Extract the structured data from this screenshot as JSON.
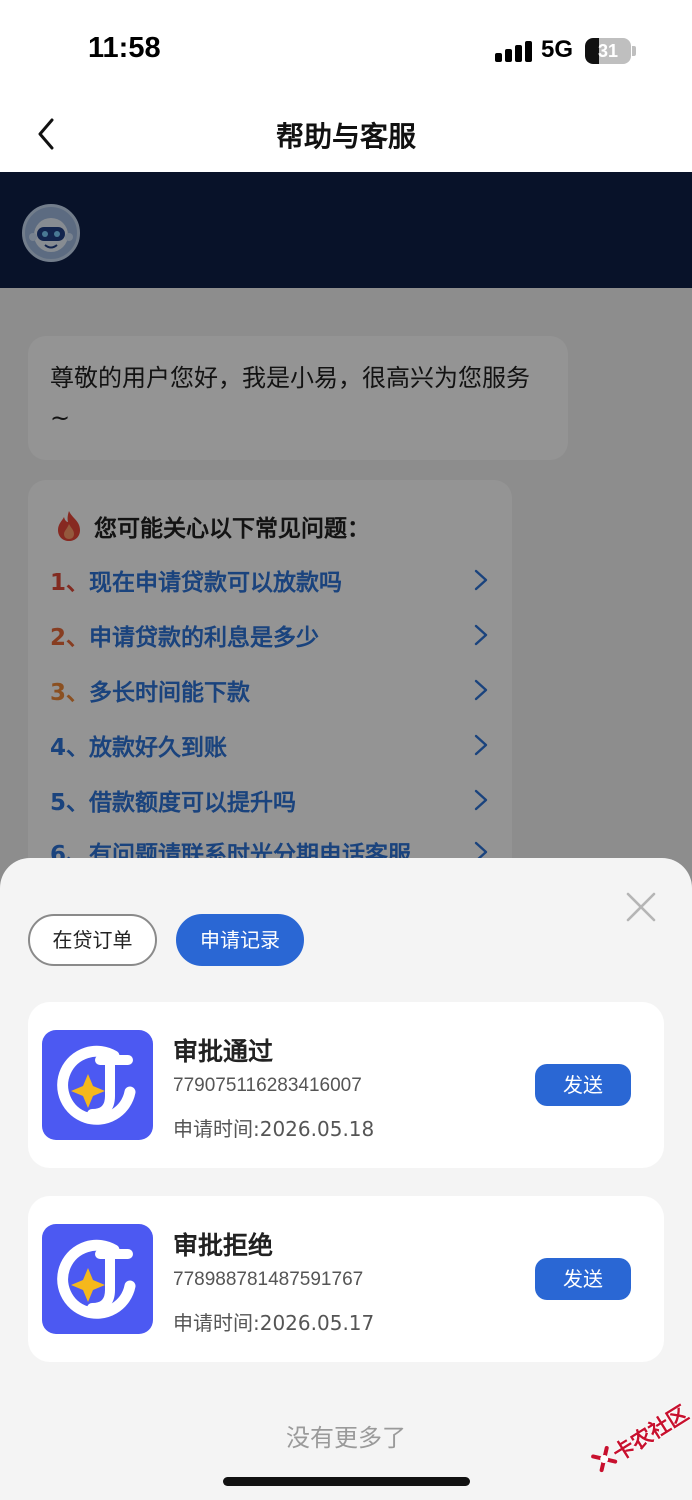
{
  "status_bar": {
    "time": "11:58",
    "network": "5G",
    "battery": "31",
    "battery_level": 0.31
  },
  "nav": {
    "title": "帮助与客服",
    "back_icon": "chevron-left-icon"
  },
  "chat": {
    "avatar_icon": "robot-avatar-icon",
    "greeting": "尊敬的用户您好，我是小易，很高兴为您服务~",
    "faq": {
      "header": "您可能关心以下常见问题：",
      "header_icon": "fire-icon",
      "items": [
        {
          "num": "1、",
          "text": "现在申请贷款可以放款吗",
          "num_color": "#e04a3a"
        },
        {
          "num": "2、",
          "text": "申请贷款的利息是多少",
          "num_color": "#e86a3a"
        },
        {
          "num": "3、",
          "text": "多长时间能下款",
          "num_color": "#ef8a3a"
        },
        {
          "num": "4、",
          "text": "放款好久到账",
          "num_color": "#2e74d8"
        },
        {
          "num": "5、",
          "text": "借款额度可以提升吗",
          "num_color": "#2e74d8"
        },
        {
          "num": "6、",
          "text": "有问题请联系时光分期电话客服",
          "num_color": "#2e74d8"
        }
      ]
    }
  },
  "sheet": {
    "close_icon": "close-icon",
    "tabs": [
      {
        "label": "在贷订单",
        "active": false
      },
      {
        "label": "申请记录",
        "active": true
      }
    ],
    "records": [
      {
        "status": "审批通过",
        "order_id": "779075116283416007",
        "apply_time": "申请时间:2026.05.18",
        "send_label": "发送"
      },
      {
        "status": "审批拒绝",
        "order_id": "778988781487591767",
        "apply_time": "申请时间:2026.05.17",
        "send_label": "发送"
      }
    ],
    "no_more": "没有更多了"
  },
  "watermark": {
    "text": "卡农社区"
  },
  "colors": {
    "accent": "#2a67d4",
    "header_bg": "#0e2048",
    "logo_bg": "#4c59f2",
    "faq_link": "#2e74d8"
  }
}
